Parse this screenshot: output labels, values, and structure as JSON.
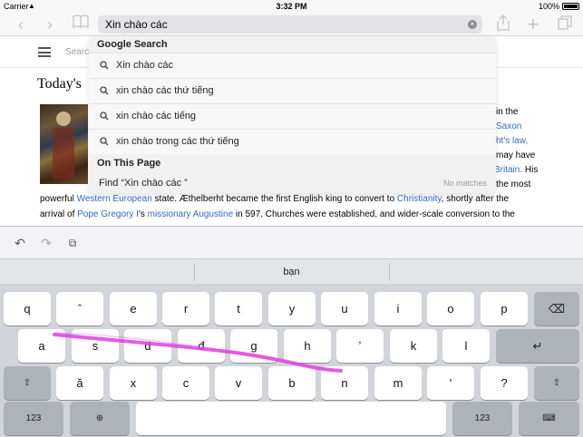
{
  "status_bar": {
    "carrier": "Carrier",
    "wifi": "▲",
    "time": "3:32 PM",
    "battery": "100%"
  },
  "toolbar": {
    "back": "‹",
    "forward": "›",
    "bookmarks": "📖",
    "url_value": "Xin chào các",
    "clear": "×",
    "share": "⇧",
    "new_tab": "+",
    "tabs": "⧉"
  },
  "page": {
    "search_placeholder": "Searc",
    "heading": "Today's",
    "right_fragments": [
      "in the",
      "Saxon",
      "ht's law,",
      "may have",
      "Britain.",
      " His",
      "the most"
    ],
    "para1": {
      "t1": "powerful ",
      "l1": "Western European",
      "t2": " state. Æthelberht became the first English king to convert to ",
      "l2": "Christianity",
      "t3": ", shortly after the"
    },
    "para2": {
      "t1": "arrival of ",
      "l1": "Pope Gregory I",
      "t2": "'s ",
      "l2": "missionary",
      "t3": " ",
      "l3": "Augustine",
      "t4": " in 597. Churches were established, and wider-scale conversion to the"
    }
  },
  "suggestions": {
    "google_title": "Google Search",
    "items": [
      "Xin chào các",
      "xin chào các thứ tiếng",
      "xin chào các tiếng",
      "xin chào trong các thứ tiếng"
    ],
    "on_page_title": "On This Page",
    "find_label": "Find “Xin chào các ”",
    "no_matches": "No matches"
  },
  "keyboard": {
    "tools": {
      "undo": "↶",
      "redo": "↷",
      "paste": "⧉"
    },
    "prediction": "bạn",
    "row1": [
      "q",
      "ˆ",
      "e",
      "r",
      "t",
      "y",
      "u",
      "i",
      "o",
      "p"
    ],
    "row2": [
      "a",
      "s",
      "d",
      "đ",
      "g",
      "h",
      "ʼ",
      "k",
      "l"
    ],
    "row3": [
      "ă",
      "x",
      "c",
      "v",
      "b",
      "n",
      "m",
      "'",
      "?"
    ],
    "backspace": "⌫",
    "return": "↵",
    "shift": "⇧",
    "numbers": "123",
    "globe": "⊕",
    "hide": "⌨",
    "swipe_color": "#e040e0"
  }
}
